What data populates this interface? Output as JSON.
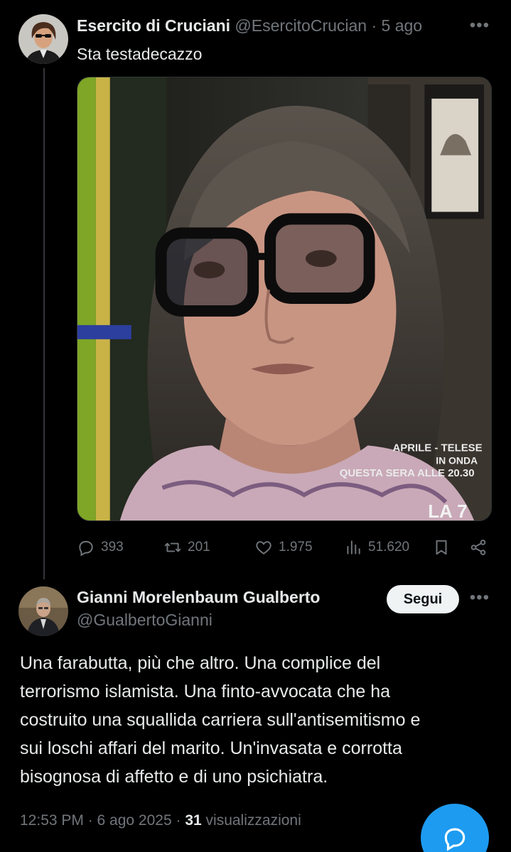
{
  "tweet1": {
    "display_name": "Esercito di Cruciani",
    "handle": "@EsercitoCrucian",
    "separator": "·",
    "time": "5 ago",
    "text": "Sta testadecazzo",
    "more_icon": "ellipsis-icon",
    "media": {
      "overlay_line1": "APRILE - TELESE",
      "overlay_line2": "IN ONDA",
      "overlay_line3": "QUESTA SERA ALLE 20.30",
      "channel_logo": "LA 7"
    },
    "actions": {
      "replies": "393",
      "reposts": "201",
      "likes": "1.975",
      "views": "51.620"
    }
  },
  "tweet2": {
    "display_name": "Gianni Morelenbaum Gualberto",
    "handle": "@GualbertoGianni",
    "follow_label": "Segui",
    "more_icon": "ellipsis-icon",
    "lines": [
      "Una farabutta, più che altro. Una complice del",
      "terrorismo islamista. Una finto-avvocata che ha",
      "costruito una squallida carriera sull'antisemitismo e",
      "sui loschi affari del marito. Un'invasata e corrotta",
      "bisognosa di affetto e di uno psichiatra."
    ],
    "timestamp": "12:53 PM · 6 ago 2025 ·",
    "views_count": "31",
    "views_label": "visualizzazioni"
  },
  "colors": {
    "background": "#000000",
    "text": "#e7e9ea",
    "secondary": "#71767b",
    "accent": "#1d9bf0"
  }
}
